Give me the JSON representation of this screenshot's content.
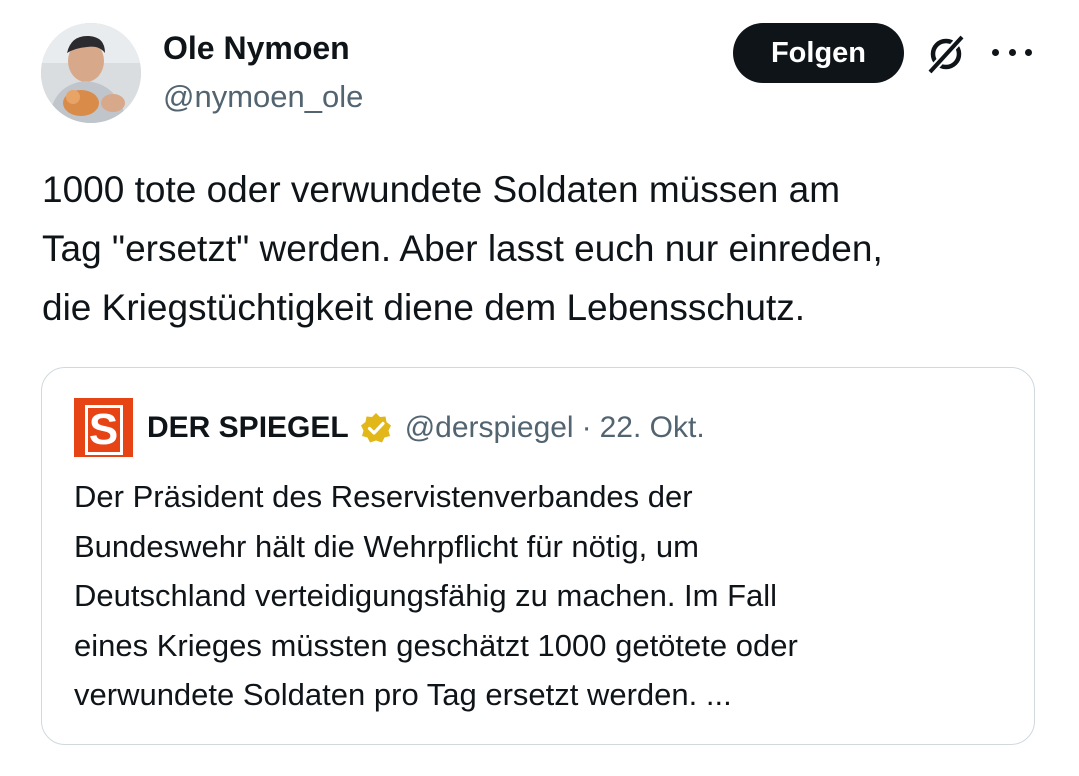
{
  "author": {
    "name": "Ole Nymoen",
    "handle": "@nymoen_ole",
    "avatar_icon": "profile-photo"
  },
  "actions": {
    "follow_label": "Folgen",
    "grok_icon": "grok-icon",
    "more_icon": "more-options-icon"
  },
  "tweet": {
    "text": "1000 tote oder verwundete Soldaten müssen am\nTag \"ersetzt\" werden. Aber lasst euch nur einreden,\ndie Kriegstüchtigkeit diene dem Lebensschutz."
  },
  "quote": {
    "logo_letter": "S",
    "name": "DER SPIEGEL",
    "verified_icon": "verified-gold-badge-icon",
    "handle": "@derspiegel",
    "separator": "·",
    "date": "22. Okt.",
    "text": "Der Präsident des Reservistenverbandes der\nBundeswehr hält die Wehrpflicht für nötig, um\nDeutschland verteidigungsfähig zu machen. Im Fall\neines Krieges müssten geschätzt 1000 getötete oder\nverwundete Soldaten pro Tag ersetzt werden. ..."
  },
  "colors": {
    "text_primary": "#0f1419",
    "text_secondary": "#536471",
    "border": "#cfd9de",
    "spiegel_orange": "#e64415",
    "verified_gold": "#e2b719"
  }
}
